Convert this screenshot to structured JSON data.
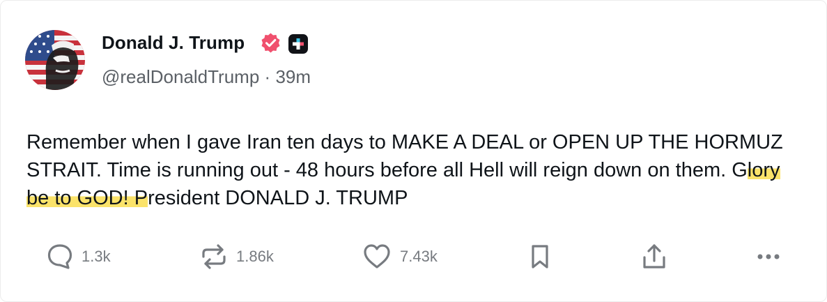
{
  "post": {
    "display_name": "Donald J. Trump",
    "handle": "@realDonaldTrump",
    "separator": "·",
    "time_ago": "39m",
    "text_before_highlight": "Remember when I gave Iran ten days to MAKE A DEAL or OPEN UP THE HORMUZ STRAIT. Time is running out - 48 hours before all Hell will reign down on them. G",
    "text_highlight": "lory be to GOD! P",
    "text_after_highlight": "resident DONALD J. TRUMP"
  },
  "actions": {
    "replies": "1.3k",
    "reposts": "1.86k",
    "likes": "7.43k"
  },
  "icons": {
    "verified": "verified-badge-icon",
    "plus": "plus-badge-icon",
    "reply": "reply-icon",
    "repost": "repost-icon",
    "like": "heart-icon",
    "bookmark": "bookmark-icon",
    "share": "share-icon",
    "more": "more-icon"
  },
  "colors": {
    "verified": "#f0506e",
    "highlight": "#fbe36a",
    "action_gray": "#777b80",
    "text": "#0f1419"
  }
}
